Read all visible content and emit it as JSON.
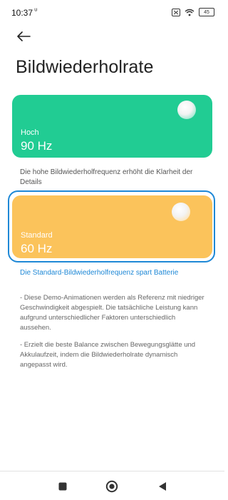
{
  "status_bar": {
    "time": "10:37",
    "battery_level": "45"
  },
  "header": {
    "title": "Bildwiederholrate"
  },
  "options": [
    {
      "mode": "Hoch",
      "rate": "90 Hz",
      "color": "#21cc93",
      "description": "Die hohe Bildwiederholfrequenz erhöht die Klarheit der Details"
    },
    {
      "mode": "Standard",
      "rate": "60 Hz",
      "color": "#fbc35b",
      "selected": true,
      "description": "Die Standard-Bildwiederholfrequenz spart Batterie"
    }
  ],
  "notes": [
    "- Diese Demo-Animationen werden als Referenz mit niedriger Geschwindigkeit abgespielt. Die tatsächliche Leistung kann aufgrund unterschiedlicher Faktoren unterschiedlich aussehen.",
    "- Erzielt die beste Balance zwischen Bewegungsglätte und Akkulaufzeit, indem die Bildwiederholrate dynamisch angepasst wird."
  ],
  "accent_color": "#1e88d6"
}
